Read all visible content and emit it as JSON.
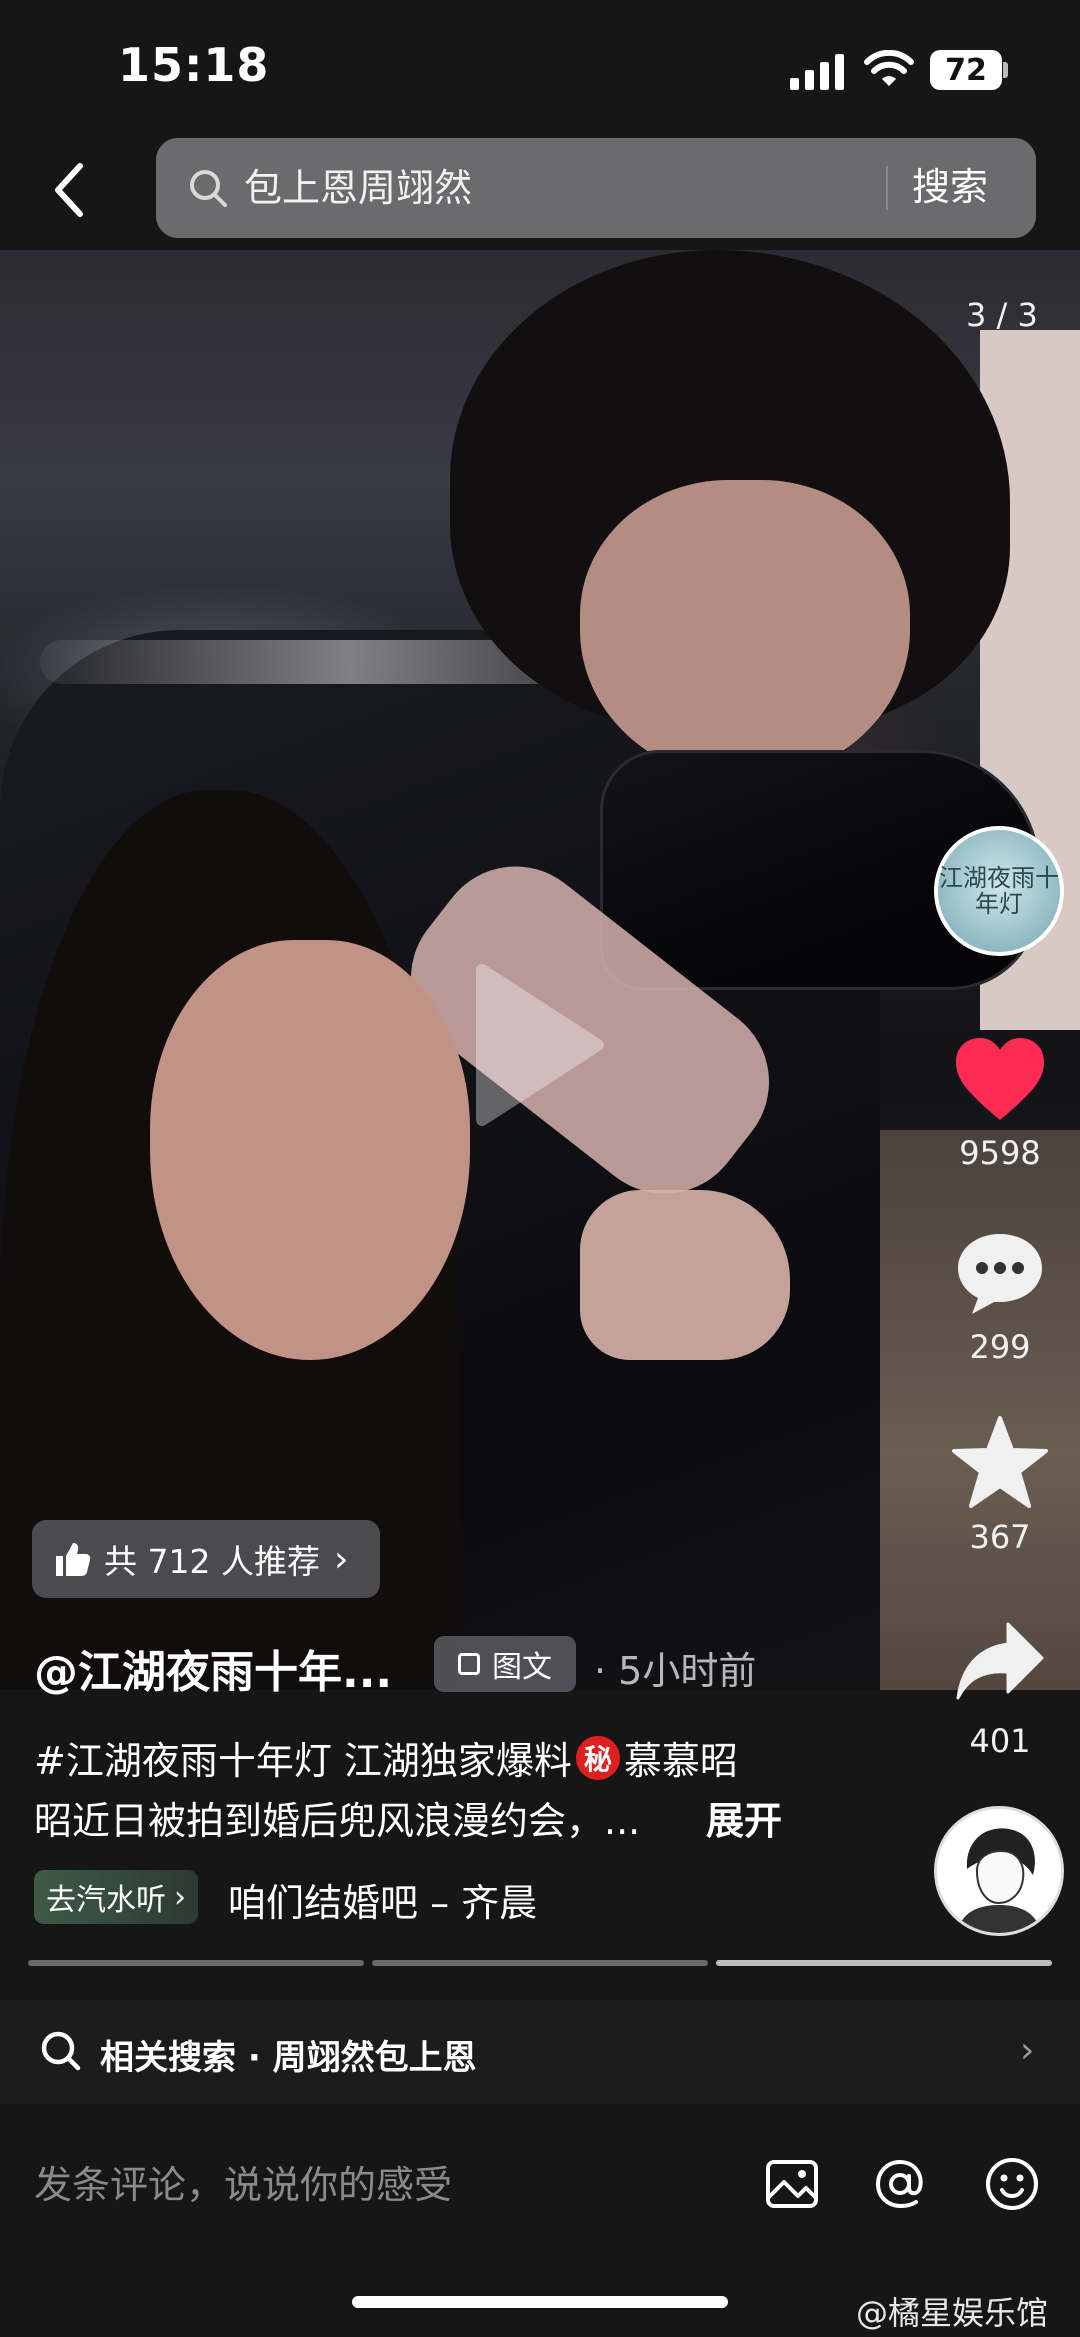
{
  "status_bar": {
    "time": "15:18",
    "battery": "72"
  },
  "search": {
    "placeholder": "包上恩周翊然",
    "button_label": "搜索"
  },
  "post": {
    "page_counter": "3 / 3",
    "recommend": "共 712 人推荐",
    "author": "@江湖夜雨十年...",
    "type_badge": "图文",
    "time_ago": "· 5小时前",
    "desc_line1_a": "#江湖夜雨十年灯 江湖独家爆料",
    "secret_badge": "秘",
    "desc_line1_b": "慕慕昭",
    "desc_line2": "昭近日被拍到婚后兜风浪漫约会，...",
    "expand_label": "展开",
    "music_chip": "去汽水听",
    "song": "咱们结婚吧 – 齐晨"
  },
  "album_text": "江湖夜雨十年灯",
  "actions": {
    "likes": "9598",
    "comments": "299",
    "favorites": "367",
    "shares": "401"
  },
  "related": {
    "label": "相关搜索 · 周翊然包上恩"
  },
  "comment_bar": {
    "placeholder": "发条评论，说说你的感受"
  },
  "watermark": "@橘星娱乐馆",
  "icons": [
    "back-icon",
    "search-icon",
    "thumbs-up-icon",
    "chevron-right-icon",
    "heart-icon",
    "comment-icon",
    "star-icon",
    "share-icon",
    "image-icon",
    "at-icon",
    "emoji-icon",
    "play-icon"
  ],
  "colors": {
    "like": "#fe2c55",
    "secret_badge": "#e02020",
    "music_chip": "#3f5a46"
  }
}
